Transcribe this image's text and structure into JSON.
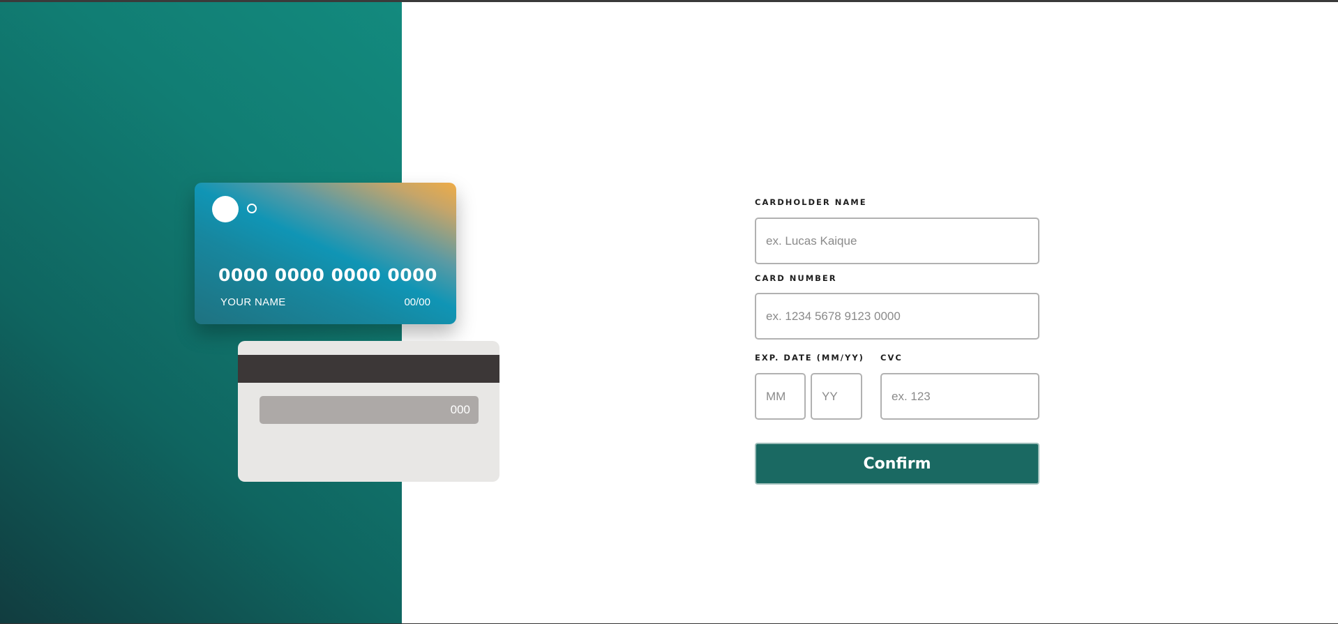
{
  "card_front": {
    "number": "0000 0000 0000 0000",
    "name": "YOUR NAME",
    "expiry": "00/00"
  },
  "card_back": {
    "cvc": "000"
  },
  "form": {
    "cardholder_label": "CARDHOLDER NAME",
    "cardholder_placeholder": "ex. Lucas Kaique",
    "number_label": "CARD NUMBER",
    "number_placeholder": "ex. 1234 5678 9123 0000",
    "exp_label": "EXP. DATE (MM/YY)",
    "month_placeholder": "MM",
    "year_placeholder": "YY",
    "cvc_label": "CVC",
    "cvc_placeholder": "ex. 123",
    "confirm_label": "Confirm"
  },
  "colors": {
    "accent": "#1a6962",
    "panel_gradient_light": "#138a7e",
    "panel_gradient_dark": "#113c3f",
    "card_back": "#e8e7e5",
    "stripe": "#3c3737"
  }
}
